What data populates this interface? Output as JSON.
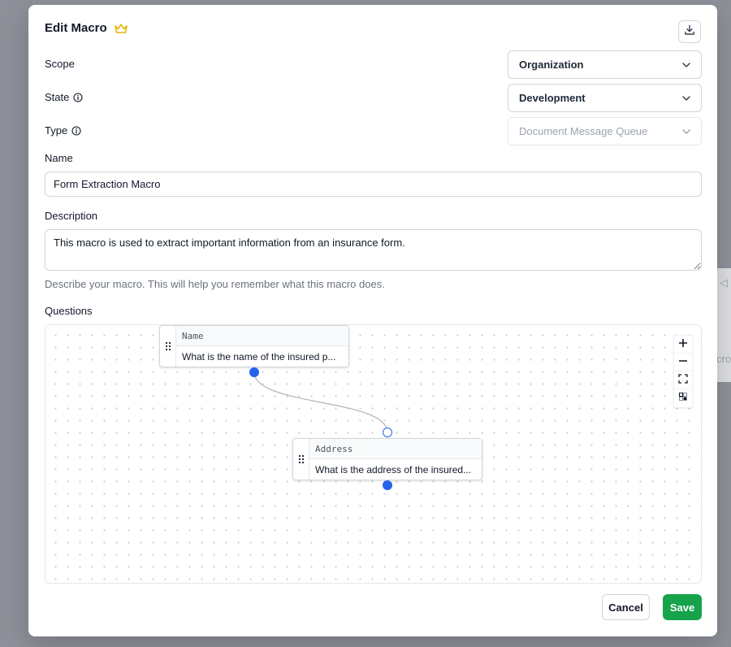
{
  "modal": {
    "title": "Edit Macro",
    "crown_icon": "crown-icon",
    "accent_crown": "#eab308"
  },
  "fields": {
    "scope": {
      "label": "Scope",
      "value": "Organization"
    },
    "state": {
      "label": "State",
      "value": "Development"
    },
    "type": {
      "label": "Type",
      "value": "Document Message Queue"
    },
    "name": {
      "label": "Name",
      "value": "Form Extraction Macro"
    },
    "description": {
      "label": "Description",
      "value": "This macro is used to extract important information from an insurance form.",
      "helper": "Describe your macro. This will help you remember what this macro does."
    }
  },
  "questions": {
    "label": "Questions",
    "nodes": [
      {
        "title": "Name",
        "text": "What is the name of the insured p..."
      },
      {
        "title": "Address",
        "text": "What is the address of the insured..."
      }
    ],
    "controls": [
      "zoom-in-icon",
      "zoom-out-icon",
      "fit-view-icon",
      "lock-icon"
    ]
  },
  "footer": {
    "cancel_label": "Cancel",
    "save_label": "Save",
    "save_color": "#16a34a"
  }
}
